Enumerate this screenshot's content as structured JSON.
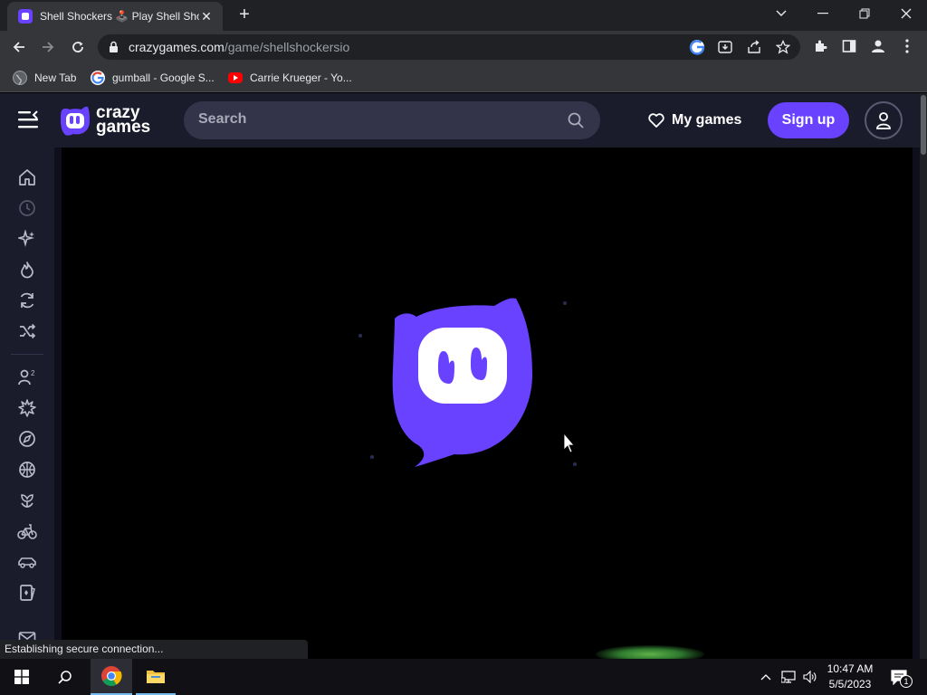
{
  "browser": {
    "tab_title": "Shell Shockers 🕹️ Play Shell Shockers",
    "url_host": "crazygames.com",
    "url_path": "/game/shellshockersio",
    "bookmarks": [
      {
        "label": "New Tab",
        "icon": "globe-icon"
      },
      {
        "label": "gumball - Google S...",
        "icon": "google-icon"
      },
      {
        "label": "Carrie Krueger - Yo...",
        "icon": "youtube-icon"
      }
    ],
    "status_text": "Establishing secure connection..."
  },
  "site": {
    "logo_top": "crazy",
    "logo_bottom": "games",
    "search_placeholder": "Search",
    "my_games_label": "My games",
    "sign_up_label": "Sign up",
    "brand_color": "#6842ff",
    "sidebar_icons": [
      "home-icon",
      "recent-icon",
      "new-icon",
      "trending-icon",
      "updated-icon",
      "random-icon",
      "multiplayer-icon",
      "action-icon",
      "adventure-icon",
      "basketball-icon",
      "casual-icon",
      "bike-icon",
      "car-icon",
      "card-icon",
      "mail-icon"
    ]
  },
  "taskbar": {
    "time": "10:47 AM",
    "date": "5/5/2023",
    "notification_count": "1"
  }
}
